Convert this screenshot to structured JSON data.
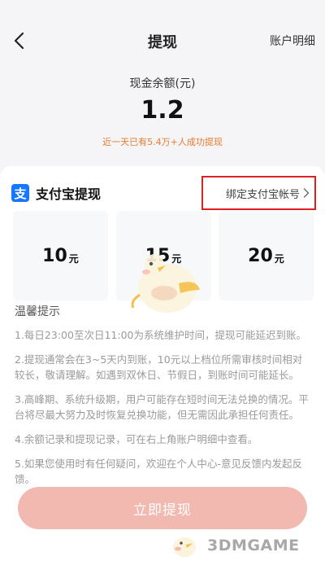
{
  "nav": {
    "title": "提现",
    "account_link": "账户明细",
    "back_icon": "chevron-left-icon"
  },
  "balance": {
    "label": "现金余额(元)",
    "value": "1.2",
    "note": "近一天已有5.4万+人成功提现",
    "note_color": "#e67c2e"
  },
  "alipay": {
    "icon": "alipay-icon",
    "icon_glyph": "支",
    "title": "支付宝提现",
    "bind_label": "绑定支付宝帐号",
    "brand_color": "#1677ff",
    "highlight_color": "#e02020"
  },
  "amounts": [
    {
      "value": "10",
      "unit": "元"
    },
    {
      "value": "15",
      "unit": "元"
    },
    {
      "value": "20",
      "unit": "元"
    }
  ],
  "tips": {
    "title": "温馨提示",
    "items": [
      "1.每日23:00至次日11:00为系统维护时间，提现可能延迟到账。",
      "2.提现通常会在3~5天内到账，10元以上档位所需审核时间相对较长，敬请理解。如遇到双休日、节假日，到账时间可能延长。",
      "3.高峰期、系统升级期，用户可能存在短时间无法兑换的情况。平台将尽最大努力及时恢复兑换功能，但无需因此承担任何责任。",
      "4.余额记录和提现记录，可在右上角账户明细中查看。",
      "5.如果您使用时有任何疑问，欢迎在个人中心-意见反馈内发起反馈。"
    ]
  },
  "submit": {
    "label": "立即提现",
    "color": "#f2b9b0"
  },
  "watermark": {
    "text": "3DMGAME"
  }
}
